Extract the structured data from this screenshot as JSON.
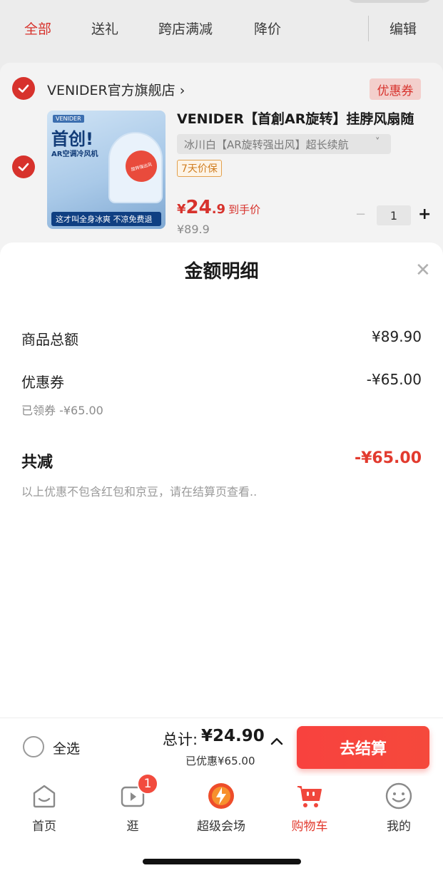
{
  "filters": {
    "tabs": [
      "全部",
      "送礼",
      "跨店满减",
      "降价"
    ],
    "active_index": 0,
    "edit_label": "编辑"
  },
  "store": {
    "name": "VENIDER官方旗舰店",
    "chevron": "›",
    "coupon_label": "优惠券"
  },
  "product": {
    "title": "VENIDER【首創AR旋转】挂脖风扇随",
    "variant": "冰川白【AR旋转强出风】超长续航",
    "variant_chevron": "˅",
    "price_guard": "7天价保",
    "price_symbol": "¥",
    "price_integer": "24",
    "price_decimal": ".9",
    "price_hint": "到手价",
    "original_price": "¥89.9",
    "quantity": "1",
    "thumb": {
      "brand": "VENIDER",
      "headline": "首创!",
      "sub": "AR空调冷风机",
      "stamp": "旋转强出风",
      "badge": "这才叫全身冰爽 不凉免费退"
    }
  },
  "sheet": {
    "title": "金额明细",
    "close_icon": "close-icon",
    "rows": [
      {
        "label": "商品总额",
        "value": "¥89.90"
      },
      {
        "label": "优惠券",
        "value": "-¥65.00"
      }
    ],
    "coupon_sub": "已领券 -¥65.00",
    "total_label": "共减",
    "total_value": "-¥65.00",
    "note": "以上优惠不包含红包和京豆，请在结算页查看.."
  },
  "checkout": {
    "select_all": "全选",
    "sum_label": "总计:",
    "sum_value": "¥24.90",
    "saved": "已优惠¥65.00",
    "button": "去结算"
  },
  "tabbar": {
    "items": [
      {
        "label": "首页",
        "icon": "home-icon"
      },
      {
        "label": "逛",
        "icon": "video-icon"
      },
      {
        "label": "超级会场",
        "icon": "event-icon"
      },
      {
        "label": "购物车",
        "icon": "cart-icon"
      },
      {
        "label": "我的",
        "icon": "profile-icon"
      }
    ],
    "active_index": 3,
    "badge_count": "1"
  },
  "colors": {
    "accent": "#e23a2e",
    "checkout_button": "#f8423e"
  }
}
